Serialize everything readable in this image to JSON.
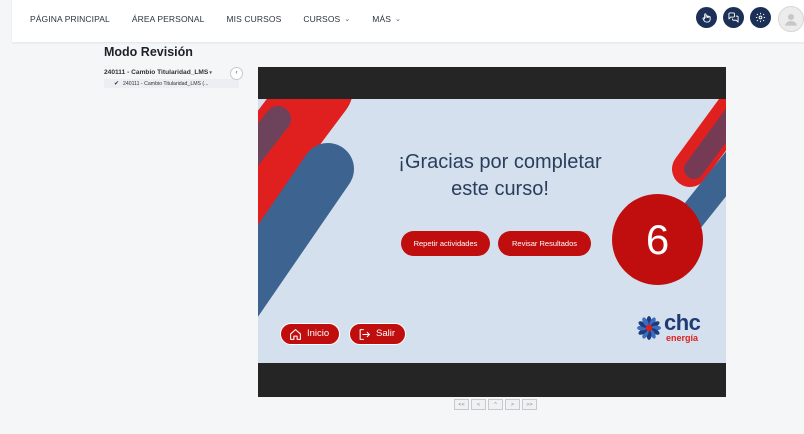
{
  "nav": {
    "items": [
      {
        "label": "PÁGINA PRINCIPAL",
        "chevron": false
      },
      {
        "label": "ÁREA PERSONAL",
        "chevron": false
      },
      {
        "label": "MIS CURSOS",
        "chevron": false
      },
      {
        "label": "CURSOS",
        "chevron": true
      },
      {
        "label": "MÁS",
        "chevron": true
      }
    ],
    "right_icons": [
      "hand-icon",
      "chat-icon",
      "settings-icon",
      "user-avatar"
    ]
  },
  "page": {
    "title": "Modo Revisión"
  },
  "tree": {
    "parent_label": "240111 - Cambio Titularidad_LMS",
    "child_label": "240111 - Cambio Titularidad_LMS (...",
    "collapse_symbol": "‹"
  },
  "slide": {
    "message_line1": "¡Gracias por completar",
    "message_line2": "este curso!",
    "button_repeat": "Repetir actividades",
    "button_review": "Revisar Resultados",
    "score": "6",
    "button_home": "Inicio",
    "button_exit": "Salir",
    "logo_main": "chc",
    "logo_sub": "energía"
  },
  "pager": {
    "buttons": [
      "<<",
      "<",
      "^",
      ">",
      ">>"
    ]
  },
  "colors": {
    "brand_red": "#c00d0d",
    "brand_navy": "#1b2f57",
    "slide_bg": "#d5e0ee",
    "logo_blue": "#1f3b76"
  }
}
